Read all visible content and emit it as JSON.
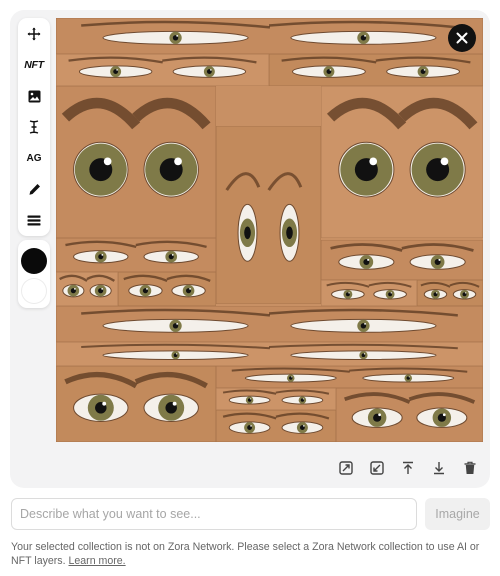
{
  "toolbar": {
    "tools": [
      {
        "name": "move-icon",
        "kind": "icon"
      },
      {
        "name": "nft-layer-button",
        "kind": "text",
        "label": "NFT"
      },
      {
        "name": "image-icon",
        "kind": "icon"
      },
      {
        "name": "text-cursor-icon",
        "kind": "icon"
      },
      {
        "name": "ai-generate-button",
        "kind": "text",
        "label": "AG"
      },
      {
        "name": "pen-icon",
        "kind": "icon"
      },
      {
        "name": "layers-icon",
        "kind": "icon"
      }
    ],
    "swatches": [
      {
        "name": "color-swatch-black",
        "color": "#0a0a0a"
      },
      {
        "name": "color-swatch-white",
        "color": "#ffffff"
      }
    ]
  },
  "canvas": {
    "content": "collage of repeated human eye crops",
    "skin_color": "#c89064",
    "iris_color": "#7f7a48"
  },
  "actions": [
    "expand-icon",
    "shrink-icon",
    "upload-icon",
    "download-icon",
    "trash-icon"
  ],
  "prompt": {
    "placeholder": "Describe what you want to see...",
    "value": ""
  },
  "imagine_label": "Imagine",
  "notice": {
    "text": "Your selected collection is not on Zora Network. Please select a Zora Network collection to use AI or NFT layers. ",
    "link": "Learn more."
  }
}
